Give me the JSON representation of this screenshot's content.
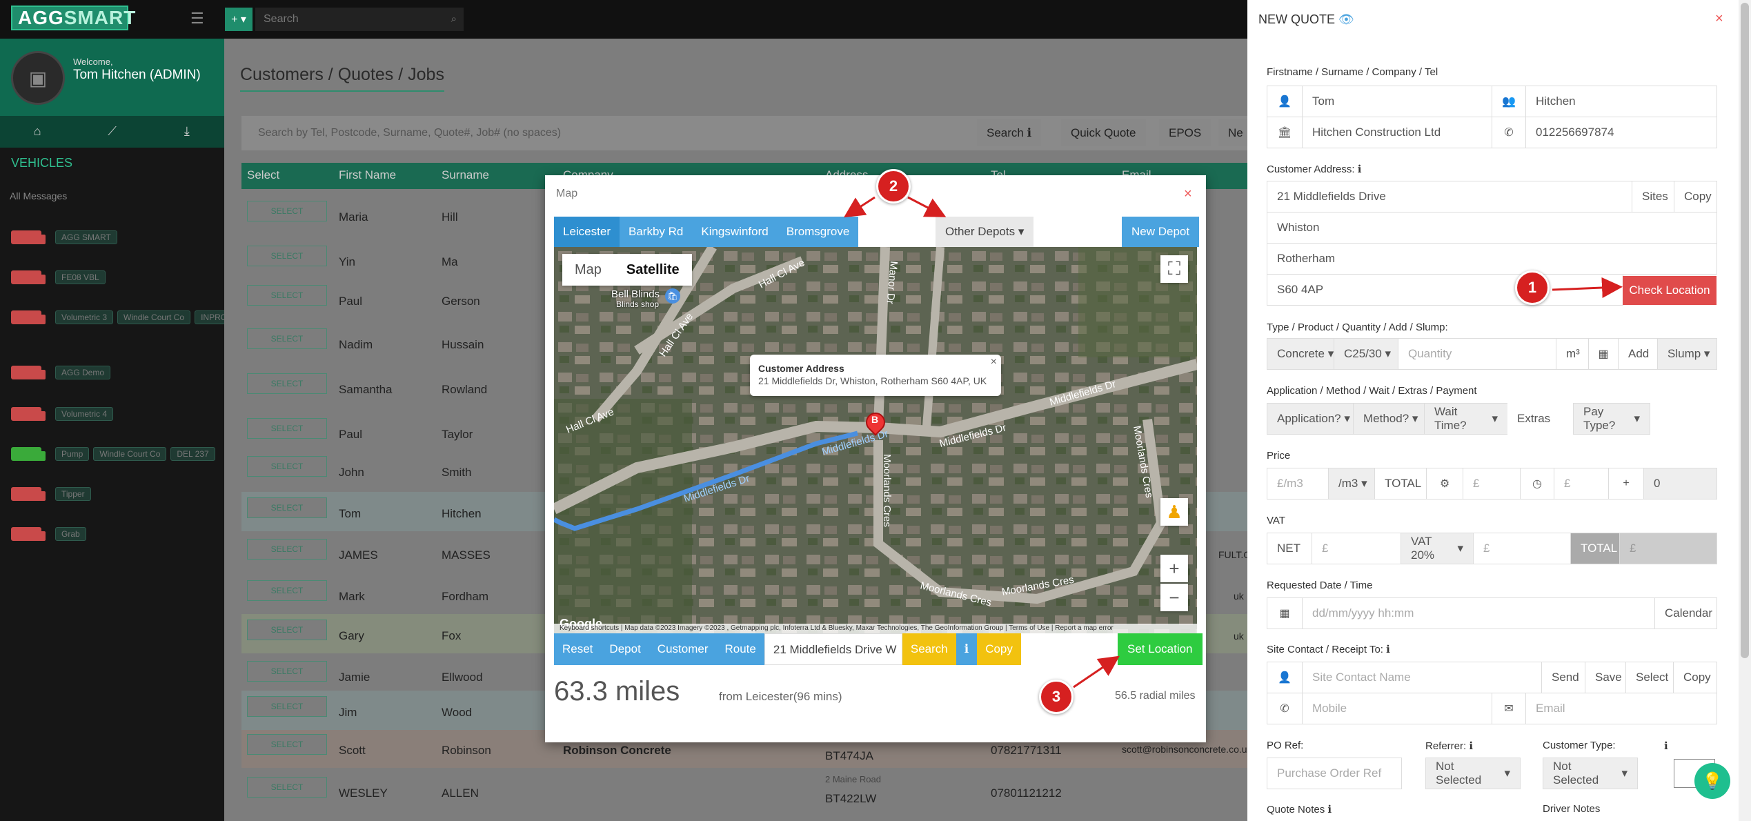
{
  "app": {
    "logo_a": "AGG",
    "logo_b": "SMART",
    "search_placeholder": "Search"
  },
  "sidebar": {
    "welcome": "Welcome,",
    "user": "Tom Hitchen (ADMIN)",
    "vehicles_heading": "VEHICLES",
    "all_messages": "All Messages",
    "vehicles": [
      {
        "color": "#c94a4a",
        "tags": [
          "AGG SMART"
        ]
      },
      {
        "color": "#c94a4a",
        "tags": [
          "FE08 VBL"
        ]
      },
      {
        "color": "#c94a4a",
        "tags": [
          "Volumetric 3",
          "Windle Court Co",
          "INPROG"
        ]
      },
      {
        "color": "#c94a4a",
        "tags": [
          "AGG Demo"
        ]
      },
      {
        "color": "#c94a4a",
        "tags": [
          "Volumetric 4"
        ]
      },
      {
        "color": "#3aaa3a",
        "tags": [
          "Pump",
          "Windle Court Co",
          "DEL 237"
        ]
      },
      {
        "color": "#c94a4a",
        "tags": [
          "Tipper"
        ]
      },
      {
        "color": "#c94a4a",
        "tags": [
          "Grab"
        ]
      }
    ]
  },
  "main": {
    "title": "Customers / Quotes / Jobs",
    "search_placeholder": "Search by Tel, Postcode, Surname, Quote#, Job# (no spaces)",
    "buttons": {
      "search": "Search",
      "quick_quote": "Quick Quote",
      "epos": "EPOS",
      "new": "Ne"
    },
    "columns": {
      "select": "Select",
      "first": "First Name",
      "surname": "Surname",
      "company": "Company",
      "address": "Address",
      "tel": "Tel",
      "email": "Email"
    },
    "select_label": "SELECT",
    "rows": [
      {
        "first": "Maria",
        "surname": "Hill"
      },
      {
        "first": "Yin",
        "surname": "Ma"
      },
      {
        "first": "Paul",
        "surname": "Gerson"
      },
      {
        "first": "Nadim",
        "surname": "Hussain"
      },
      {
        "first": "Samantha",
        "surname": "Rowland"
      },
      {
        "first": "Paul",
        "surname": "Taylor"
      },
      {
        "first": "John",
        "surname": "Smith"
      },
      {
        "first": "Tom",
        "surname": "Hitchen"
      },
      {
        "first": "JAMES",
        "surname": "MASSES"
      },
      {
        "first": "Mark",
        "surname": "Fordham"
      },
      {
        "first": "Gary",
        "surname": "Fox"
      },
      {
        "first": "Jamie",
        "surname": "Ellwood"
      },
      {
        "first": "Jim",
        "surname": "Wood"
      },
      {
        "first": "Scott",
        "surname": "Robinson",
        "company": "Robinson Concrete",
        "address": "BT474JA",
        "tel": "07821771311",
        "email": "scott@robinsonconcrete.co.u"
      },
      {
        "first": "WESLEY",
        "surname": "ALLEN",
        "address_line": "2 Maine Road",
        "address": "BT422LW",
        "tel": "07801121212"
      }
    ],
    "row_fragments": {
      "email_a": "FULT.CO",
      "email_b": "uk",
      "email_c": "uk"
    }
  },
  "map_modal": {
    "title": "Map",
    "depots": [
      "Leicester",
      "Barkby Rd",
      "Kingswinford",
      "Bromsgrove"
    ],
    "other_depots": "Other Depots",
    "new_depot": "New Depot",
    "view_map": "Map",
    "view_satellite": "Satellite",
    "poi_name": "Bell Blinds",
    "poi_sub": "Blinds shop",
    "info_title": "Customer Address",
    "info_address": "21 Middlefields Dr, Whiston, Rotherham S60 4AP, UK",
    "pin_label": "B",
    "streets": [
      "Hall Cl Ave",
      "Hall Cl Ave",
      "Hall Cl Ave",
      "Manor Dr",
      "Middlefields Dr",
      "Middlefields Dr",
      "Middlefields Dr",
      "Middlefields Dr",
      "Moorlands Cres",
      "Moorlands Cres",
      "Moorlands Cres",
      "Moorlands Cres"
    ],
    "footer": "Keyboard shortcuts  |  Map data ©2023 Imagery ©2023 , Getmapping plc, Infoterra Ltd & Bluesky, Maxar Technologies, The GeoInformation Group  |  Terms of Use  |  Report a map error",
    "google": "Google",
    "route": {
      "reset": "Reset",
      "depot": "Depot",
      "customer": "Customer",
      "route": "Route",
      "address": "21 Middlefields Drive W",
      "search": "Search",
      "copy": "Copy",
      "set_location": "Set Location"
    },
    "distance": "63.3 miles",
    "from": "from Leicester(96 mins)",
    "radial": "56.5 radial miles"
  },
  "badges": [
    "1",
    "2",
    "3"
  ],
  "quote": {
    "title": "NEW QUOTE",
    "name_label": "Firstname / Surname / Company / Tel",
    "firstname": "Tom",
    "surname": "Hitchen",
    "company": "Hitchen Construction Ltd",
    "tel": "012256697874",
    "address_label": "Customer Address:",
    "addr1": "21 Middlefields Drive",
    "addr2": "Whiston",
    "addr3": "Rotherham",
    "postcode": "S60 4AP",
    "sites": "Sites",
    "copy": "Copy",
    "check_location": "Check Location",
    "type_label": "Type / Product / Quantity / Add / Slump:",
    "type": "Concrete",
    "product": "C25/30",
    "quantity_ph": "Quantity",
    "m3": "m³",
    "add": "Add",
    "slump": "Slump",
    "app_label": "Application / Method / Wait / Extras / Payment",
    "application": "Application?",
    "method": "Method?",
    "wait": "Wait Time?",
    "extras": "Extras",
    "paytype": "Pay Type?",
    "price_label": "Price",
    "price_ph": "£/m3",
    "per": "/m3",
    "total": "TOTAL",
    "pound": "£",
    "zero": "0",
    "vat_label": "VAT",
    "net": "NET",
    "vat": "VAT 20%",
    "total2": "TOTAL",
    "date_label": "Requested Date / Time",
    "date_ph": "dd/mm/yyyy hh:mm",
    "calendar": "Calendar",
    "contact_label": "Site Contact / Receipt To:",
    "contact_ph": "Site Contact Name",
    "send": "Send",
    "save": "Save",
    "select": "Select",
    "copy2": "Copy",
    "mobile_ph": "Mobile",
    "email_ph": "Email",
    "po_label": "PO Ref:",
    "po_ph": "Purchase Order Ref",
    "referrer_label": "Referrer:",
    "referrer": "Not Selected",
    "ctype_label": "Customer Type:",
    "ctype": "Not Selected",
    "quote_notes": "Quote Notes",
    "driver_notes": "Driver Notes"
  }
}
